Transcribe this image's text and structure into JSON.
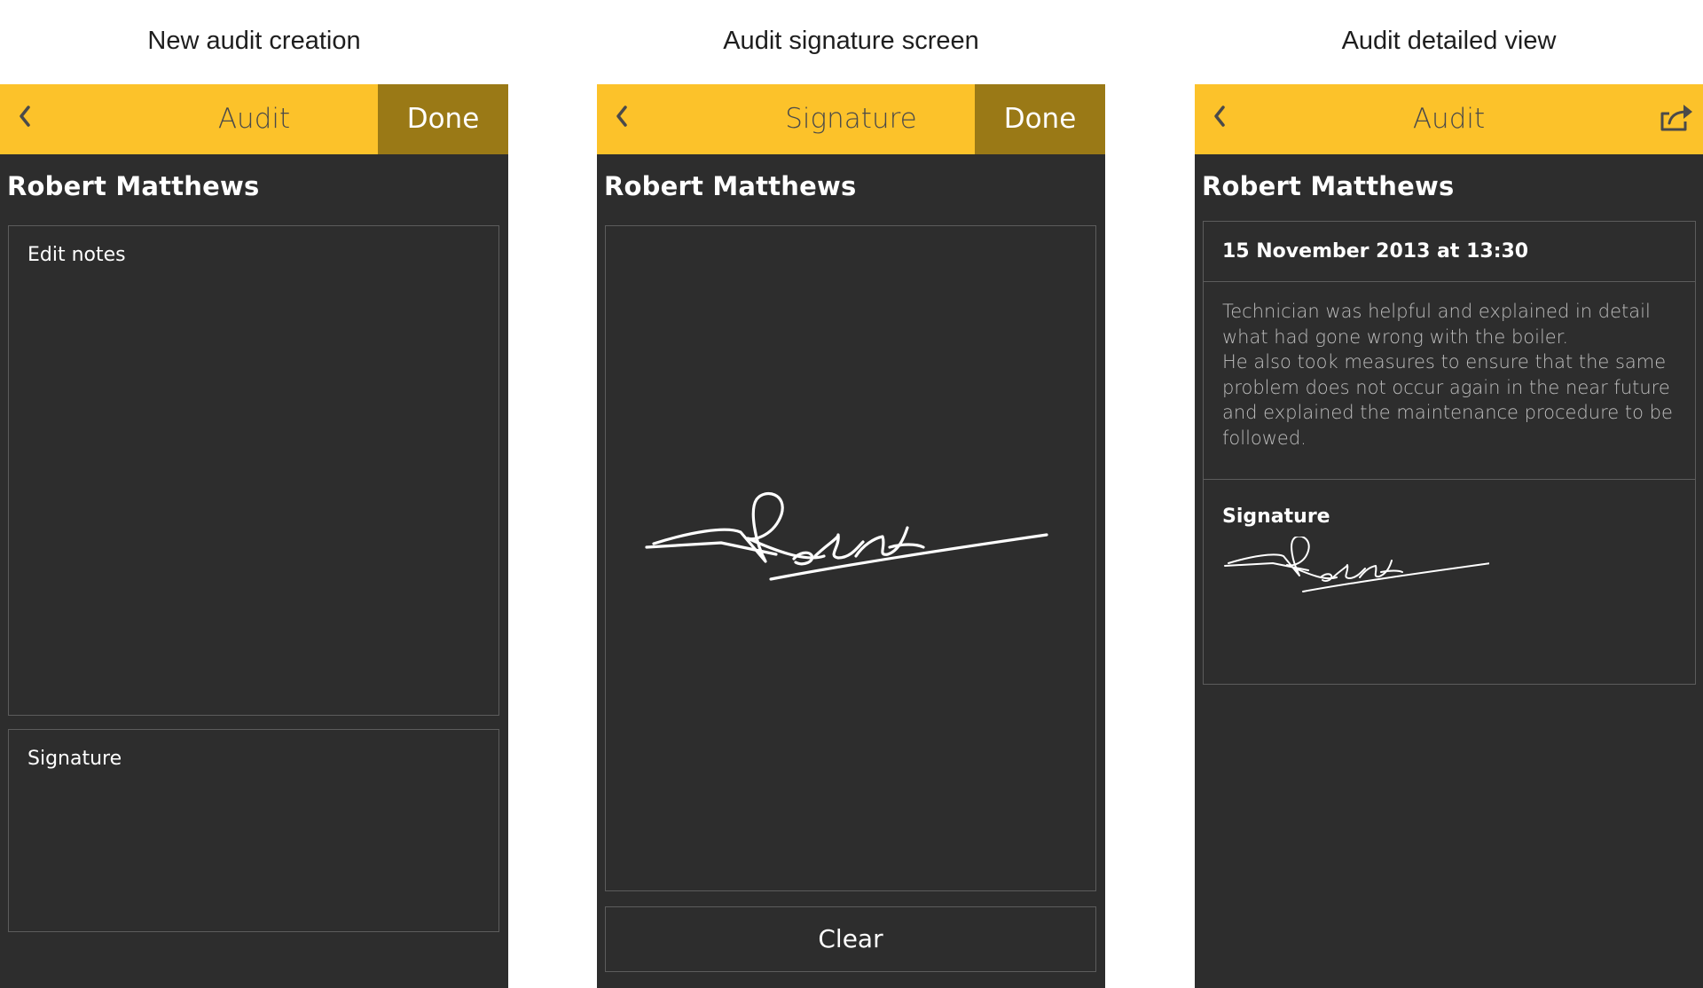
{
  "captions": {
    "left": "New audit creation",
    "middle": "Audit signature screen",
    "right": "Audit detailed view"
  },
  "colors": {
    "navbar": "#fcc22a",
    "done_button": "#9a7916",
    "panel_background": "#2d2d2d",
    "border": "#5c5c5c"
  },
  "screens": {
    "creation": {
      "nav_title": "Audit",
      "done_label": "Done",
      "back_icon": "chevron-left-icon",
      "person_name": "Robert Matthews",
      "notes_placeholder": "Edit notes",
      "signature_label": "Signature"
    },
    "signature": {
      "nav_title": "Signature",
      "done_label": "Done",
      "back_icon": "chevron-left-icon",
      "person_name": "Robert Matthews",
      "clear_label": "Clear"
    },
    "detail": {
      "nav_title": "Audit",
      "back_icon": "chevron-left-icon",
      "share_icon": "share-icon",
      "person_name": "Robert Matthews",
      "date": "15 November 2013 at 13:30",
      "notes_lines": [
        "Technician was helpful and explained in detail",
        "what had gone wrong with the boiler.",
        "He also took measures to ensure that the same",
        "problem does not occur again in the near future",
        "and explained the maintenance procedure to be",
        "followed."
      ],
      "signature_label": "Signature"
    }
  }
}
